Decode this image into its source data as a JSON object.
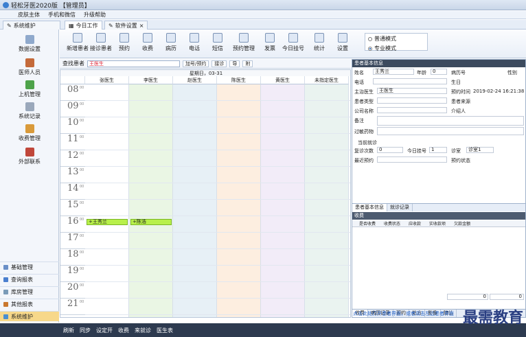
{
  "title": "轻松牙医2020版 【管理员】",
  "menu": [
    "皮肤主体",
    "手机和微信",
    "升级帮助"
  ],
  "tabs": {
    "nav_label": "系统维护",
    "tab1": "今日工作",
    "tab2": "软件设置"
  },
  "left_nav": {
    "top_items": [
      "数据设置",
      "医师人员",
      "上机管理",
      "系统记录",
      "收费管理",
      "外部联系"
    ],
    "list_items": [
      "基础管理",
      "查询报表",
      "库房管理",
      "其他报表",
      "系统维护"
    ]
  },
  "toolbar": {
    "buttons": [
      "新增患者",
      "接诊患者",
      "预约",
      "收费",
      "病历",
      "电话",
      "短信",
      "预约管理",
      "发票",
      "今日挂号",
      "统计",
      "设置"
    ],
    "radio1": "普通模式",
    "radio2": "专业模式"
  },
  "subtool": {
    "label": "查找患者",
    "value": "王医生",
    "btn1": "加号/预约",
    "btn2": "接诊",
    "btn3": "导",
    "btn4": "附"
  },
  "calendar": {
    "date_line": "星期日，03-31",
    "doctors": [
      "张医生",
      "李医生",
      "赵医生",
      "陈医生",
      "黄医生",
      "未指定医生"
    ],
    "hours": [
      "08",
      "09",
      "10",
      "11",
      "12",
      "13",
      "14",
      "15",
      "16",
      "17",
      "18",
      "19",
      "20",
      "21"
    ],
    "appointments": [
      {
        "text": "+王秀兰",
        "col": 0,
        "hour": "16"
      },
      {
        "text": "+陈浩",
        "col": 1,
        "hour": "16"
      }
    ]
  },
  "right_panel": {
    "header1": "患者基本信息",
    "labels": {
      "name": "姓名",
      "name_val": "王秀兰",
      "age": "年龄",
      "age_val": "0",
      "record": "病历号",
      "gender": "性别",
      "phone": "电话",
      "birth": "生日",
      "doctor": "主治医生",
      "doctor_val": "王医生",
      "time": "预约时间",
      "time_val": "2019-02-24 16:21:38",
      "type": "患者类型",
      "source": "患者来源",
      "company": "公司名称",
      "refer": "介绍人",
      "memo": "备注",
      "allergy": "过敏药物",
      "visit_section": "当前就诊",
      "visits": "复诊次数",
      "visits_val": "0",
      "today_no": "今日挂号",
      "today_val": "1",
      "room": "诊室",
      "room_val": "诊室1",
      "recent": "最近预约",
      "pre": "预约状态"
    },
    "tabs": [
      "患者基本信息",
      "就诊记录"
    ],
    "sub_header": "收费",
    "grid_cols": [
      "是否收费",
      "收费状态",
      "应收款",
      "实收款项",
      "欠款金额"
    ],
    "total_a": "0",
    "total_b": "0",
    "bottom_link": "点击此处打开患者界面，或者双击左边患者界面",
    "bottom_tabs": [
      "收费",
      "病历记录",
      "预约",
      "处方",
      "影像",
      "随访"
    ]
  },
  "status": [
    "刷新",
    "同步",
    "设定开",
    "收费",
    "来就诊",
    "医生表"
  ],
  "watermark": "最需教育"
}
